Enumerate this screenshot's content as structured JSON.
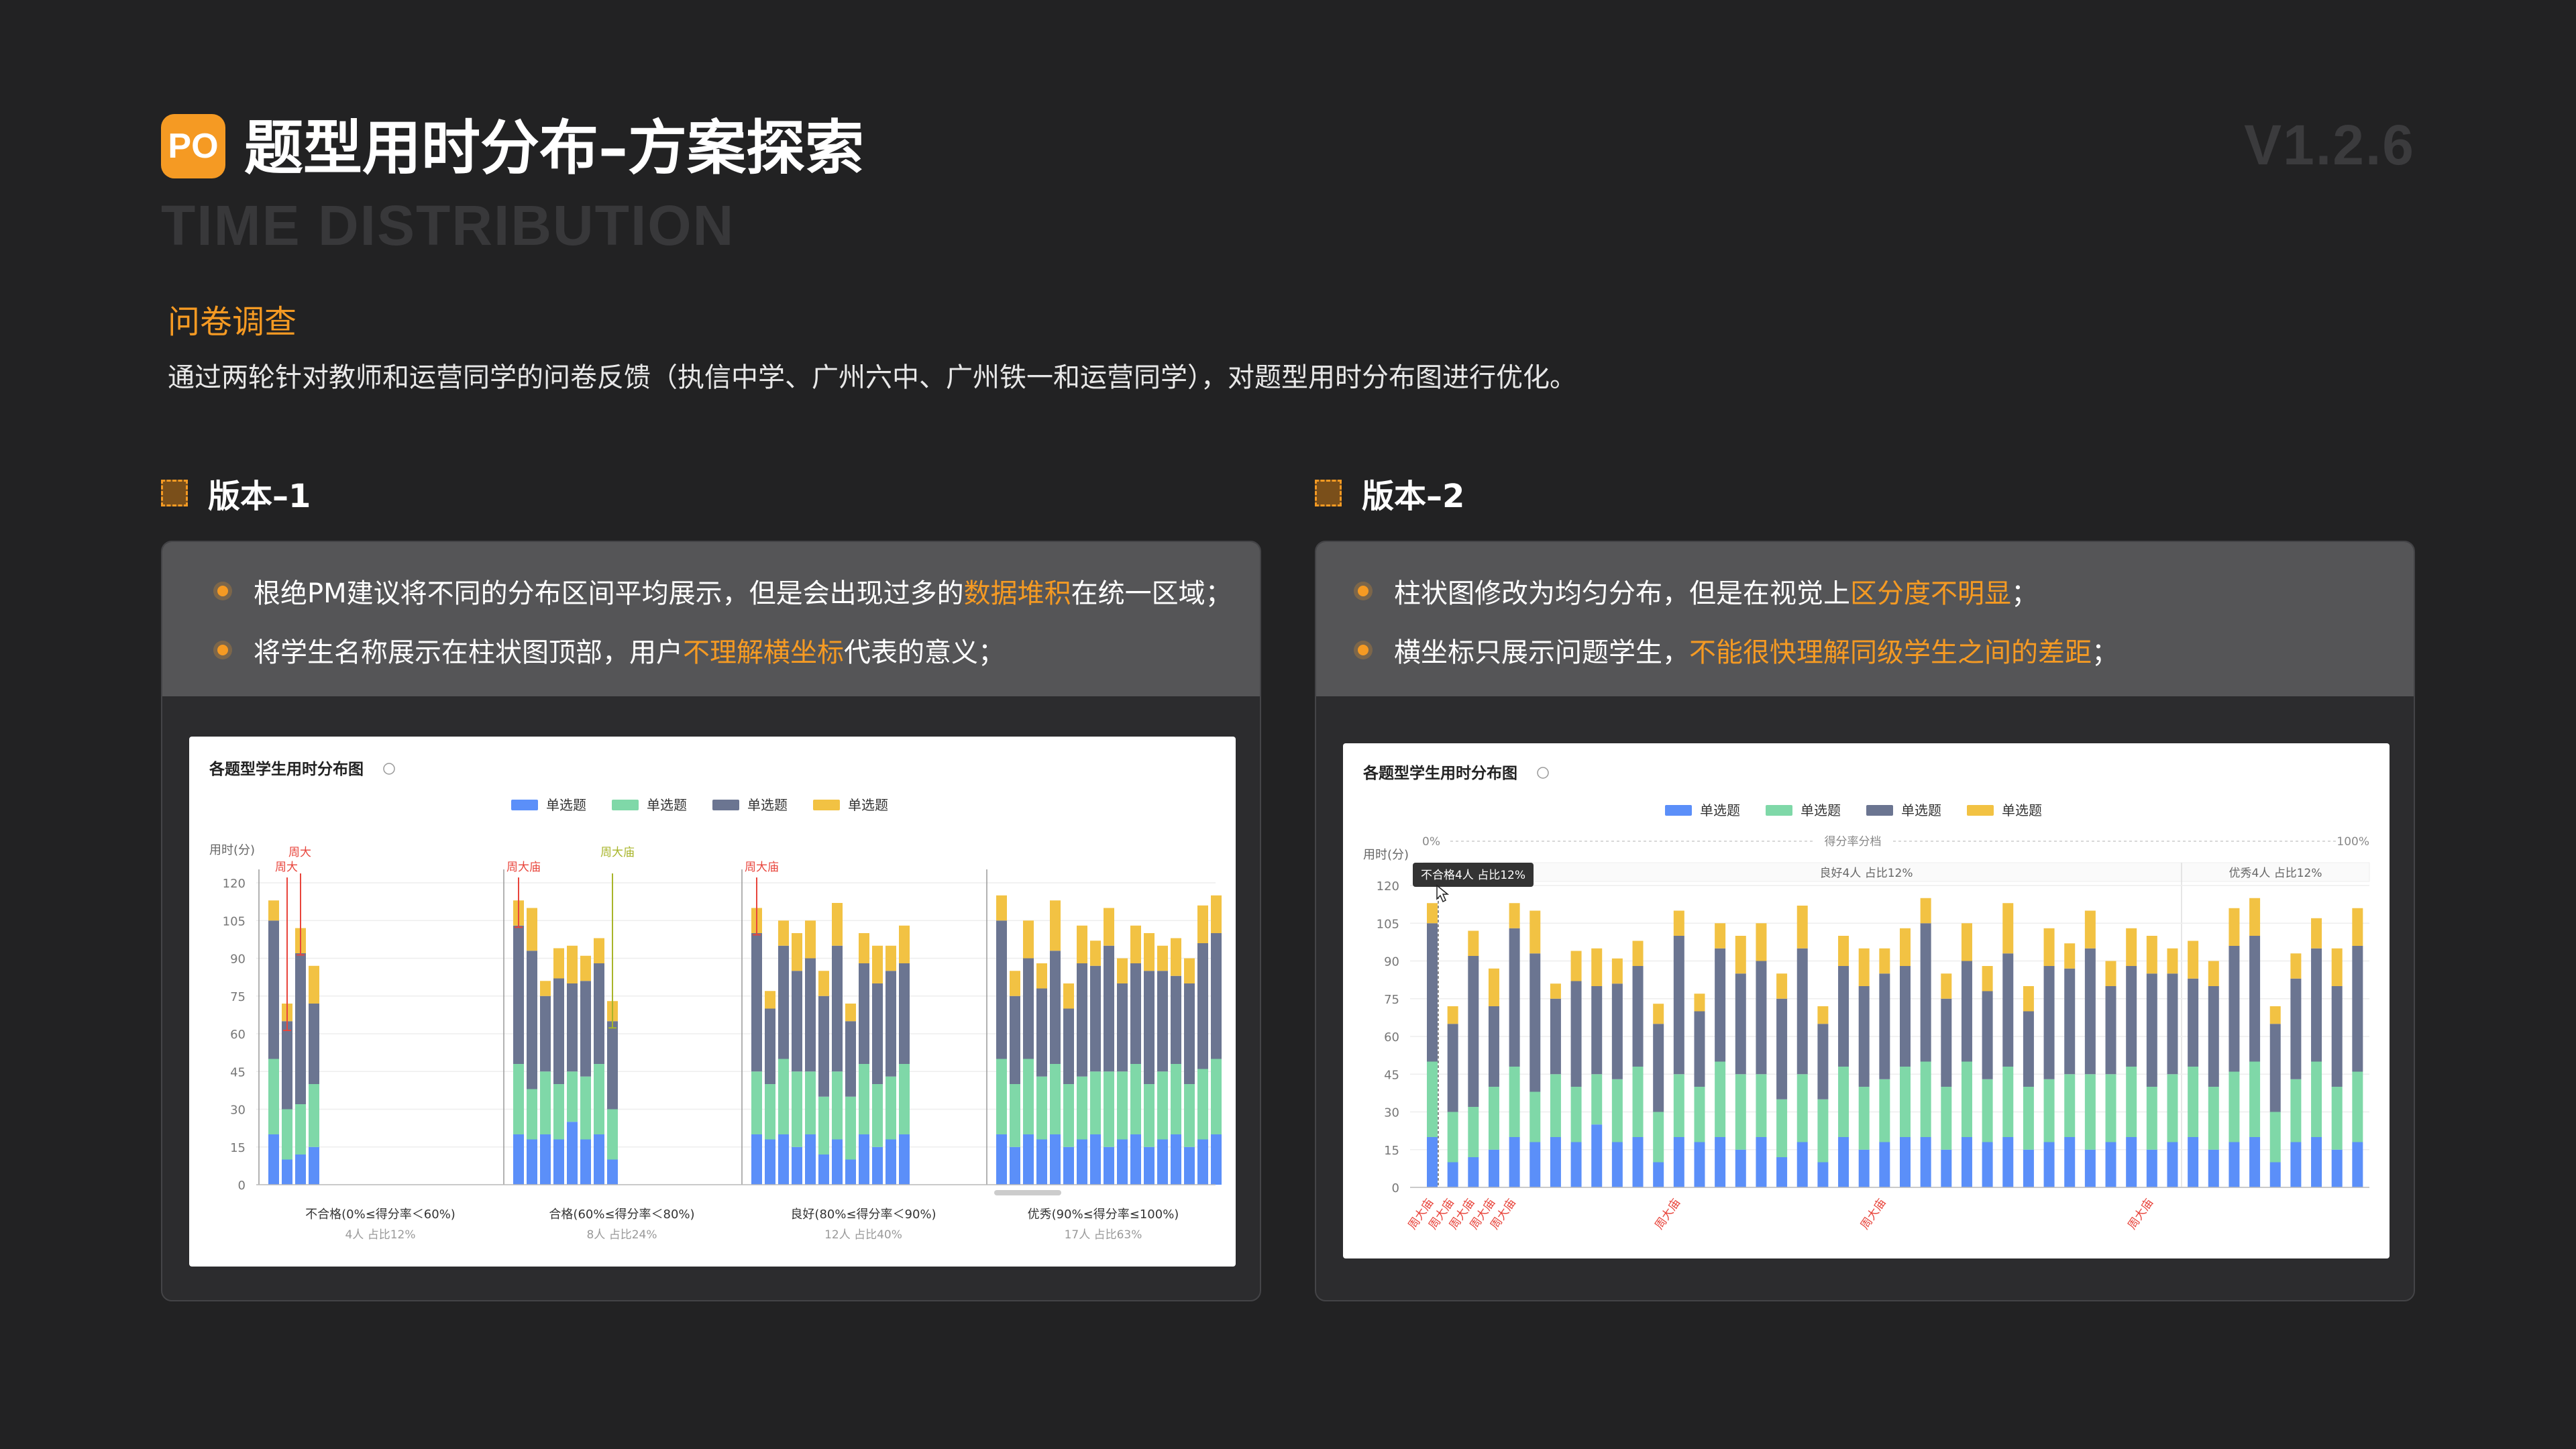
{
  "header": {
    "logo_text": "PO",
    "title": "题型用时分布–方案探索",
    "subtitle_en": "TIME DISTRIBUTION",
    "version": "V1.2.6"
  },
  "intro": {
    "section_title": "问卷调查",
    "description": "通过两轮针对教师和运营同学的问卷反馈（执信中学、广州六中、广州铁一和运营同学），对题型用时分布图进行优化。"
  },
  "version1": {
    "heading": "版本–1",
    "bullets": [
      {
        "pre": "根绝PM建议将不同的分布区间平均展示，但是会出现过多的",
        "hl": "数据堆积",
        "post": "在统一区域；"
      },
      {
        "pre": "将学生名称展示在柱状图顶部，用户",
        "hl": "不理解横坐标",
        "post": "代表的意义；"
      }
    ],
    "chart": {
      "title": "各题型学生用时分布图",
      "ylabel": "用时(分)",
      "legend": [
        "单选题",
        "单选题",
        "单选题",
        "单选题"
      ],
      "group_labels": [
        "不合格(0%≤得分率＜60%)",
        "合格(60%≤得分率＜80%)",
        "良好(80%≤得分率＜90%)",
        "优秀(90%≤得分率≤100%)"
      ],
      "group_counts": [
        "4人 占比12%",
        "8人 占比24%",
        "12人 占比40%",
        "17人 占比63%"
      ],
      "annotations": [
        "周大",
        "周大",
        "周大庙",
        "周大庙",
        "周大庙"
      ]
    }
  },
  "version2": {
    "heading": "版本–2",
    "bullets": [
      {
        "pre": "柱状图修改为均匀分布，但是在视觉上",
        "hl": "区分度不明显",
        "post": "；"
      },
      {
        "pre": "横坐标只展示问题学生，",
        "hl": "不能很快理解同级学生之间的差距",
        "post": "；"
      }
    ],
    "chart": {
      "title": "各题型学生用时分布图",
      "ylabel": "用时(分)",
      "legend": [
        "单选题",
        "单选题",
        "单选题",
        "单选题"
      ],
      "scale_left": "0%",
      "scale_mid": "得分率分档",
      "scale_right": "100%",
      "band_labels": [
        "良好4人 占比12%",
        "优秀4人 占比12%"
      ],
      "tooltip": "不合格4人 占比12%",
      "x_labels": [
        "周大庙",
        "周大庙",
        "周大庙",
        "周大庙",
        "周大庙",
        "周大庙",
        "周大庙",
        "周大庙"
      ]
    }
  },
  "colors": {
    "accent": "#F59A23",
    "bar_blue": "#5B8FF9",
    "bar_green": "#7FD8A8",
    "bar_slate": "#6B7591",
    "bar_yellow": "#F2C243",
    "annot_red": "#E8453C",
    "annot_olive": "#A8B52A"
  },
  "chart_data": [
    {
      "type": "bar",
      "stacked": true,
      "title": "各题型学生用时分布图",
      "ylabel": "用时(分)",
      "ylim": [
        0,
        120
      ],
      "yticks": [
        0,
        15,
        30,
        45,
        60,
        75,
        90,
        105,
        120
      ],
      "series": [
        {
          "name": "单选题",
          "color": "#5B8FF9"
        },
        {
          "name": "单选题",
          "color": "#7FD8A8"
        },
        {
          "name": "单选题",
          "color": "#6B7591"
        },
        {
          "name": "单选题",
          "color": "#F2C243"
        }
      ],
      "groups": [
        {
          "label": "不合格(0%≤得分率＜60%)",
          "bars": [
            [
              20,
              30,
              55,
              8
            ],
            [
              10,
              20,
              35,
              7
            ],
            [
              12,
              20,
              60,
              10
            ],
            [
              15,
              25,
              32,
              15
            ]
          ]
        },
        {
          "label": "合格(60%≤得分率＜80%)",
          "bars": [
            [
              20,
              28,
              55,
              10
            ],
            [
              18,
              20,
              55,
              17
            ],
            [
              20,
              25,
              30,
              6
            ],
            [
              18,
              22,
              42,
              12
            ],
            [
              25,
              20,
              35,
              15
            ],
            [
              18,
              25,
              38,
              10
            ],
            [
              20,
              28,
              40,
              10
            ],
            [
              10,
              20,
              35,
              8
            ]
          ]
        },
        {
          "label": "良好(80%≤得分率＜90%)",
          "bars": [
            [
              20,
              25,
              55,
              10
            ],
            [
              18,
              22,
              30,
              7
            ],
            [
              20,
              30,
              45,
              10
            ],
            [
              15,
              30,
              40,
              15
            ],
            [
              20,
              25,
              45,
              15
            ],
            [
              12,
              23,
              40,
              10
            ],
            [
              18,
              27,
              50,
              17
            ],
            [
              10,
              25,
              30,
              7
            ],
            [
              20,
              28,
              40,
              12
            ],
            [
              15,
              25,
              40,
              15
            ],
            [
              18,
              25,
              42,
              10
            ],
            [
              20,
              28,
              40,
              15
            ]
          ]
        },
        {
          "label": "优秀(90%≤得分率≤100%)",
          "bars": [
            [
              20,
              30,
              55,
              10
            ],
            [
              15,
              25,
              35,
              10
            ],
            [
              20,
              30,
              40,
              15
            ],
            [
              18,
              25,
              35,
              10
            ],
            [
              20,
              28,
              45,
              20
            ],
            [
              15,
              25,
              30,
              10
            ],
            [
              18,
              25,
              45,
              15
            ],
            [
              20,
              25,
              42,
              10
            ],
            [
              15,
              30,
              50,
              15
            ],
            [
              18,
              27,
              35,
              10
            ],
            [
              20,
              28,
              40,
              15
            ],
            [
              15,
              25,
              45,
              15
            ],
            [
              18,
              27,
              40,
              10
            ],
            [
              20,
              28,
              35,
              15
            ],
            [
              15,
              25,
              40,
              10
            ],
            [
              18,
              28,
              50,
              15
            ],
            [
              20,
              30,
              50,
              15
            ]
          ]
        }
      ]
    },
    {
      "type": "bar",
      "stacked": true,
      "title": "各题型学生用时分布图",
      "ylabel": "用时(分)",
      "ylim": [
        0,
        120
      ],
      "yticks": [
        0,
        15,
        30,
        45,
        60,
        75,
        90,
        105,
        120
      ],
      "series": [
        {
          "name": "单选题",
          "color": "#5B8FF9"
        },
        {
          "name": "单选题",
          "color": "#7FD8A8"
        },
        {
          "name": "单选题",
          "color": "#6B7591"
        },
        {
          "name": "单选题",
          "color": "#F2C243"
        }
      ],
      "bars": [
        [
          20,
          30,
          55,
          8
        ],
        [
          10,
          20,
          35,
          7
        ],
        [
          12,
          20,
          60,
          10
        ],
        [
          15,
          25,
          32,
          15
        ],
        [
          20,
          28,
          55,
          10
        ],
        [
          18,
          20,
          55,
          17
        ],
        [
          20,
          25,
          30,
          6
        ],
        [
          18,
          22,
          42,
          12
        ],
        [
          25,
          20,
          35,
          15
        ],
        [
          18,
          25,
          38,
          10
        ],
        [
          20,
          28,
          40,
          10
        ],
        [
          10,
          20,
          35,
          8
        ],
        [
          20,
          25,
          55,
          10
        ],
        [
          18,
          22,
          30,
          7
        ],
        [
          20,
          30,
          45,
          10
        ],
        [
          15,
          30,
          40,
          15
        ],
        [
          20,
          25,
          45,
          15
        ],
        [
          12,
          23,
          40,
          10
        ],
        [
          18,
          27,
          50,
          17
        ],
        [
          10,
          25,
          30,
          7
        ],
        [
          20,
          28,
          40,
          12
        ],
        [
          15,
          25,
          40,
          15
        ],
        [
          18,
          25,
          42,
          10
        ],
        [
          20,
          28,
          40,
          15
        ],
        [
          20,
          30,
          55,
          10
        ],
        [
          15,
          25,
          35,
          10
        ],
        [
          20,
          30,
          40,
          15
        ],
        [
          18,
          25,
          35,
          10
        ],
        [
          20,
          28,
          45,
          20
        ],
        [
          15,
          25,
          30,
          10
        ],
        [
          18,
          25,
          45,
          15
        ],
        [
          20,
          25,
          42,
          10
        ],
        [
          15,
          30,
          50,
          15
        ],
        [
          18,
          27,
          35,
          10
        ],
        [
          20,
          28,
          40,
          15
        ],
        [
          15,
          25,
          45,
          15
        ],
        [
          18,
          27,
          40,
          10
        ],
        [
          20,
          28,
          35,
          15
        ],
        [
          15,
          25,
          40,
          10
        ],
        [
          18,
          28,
          50,
          15
        ],
        [
          20,
          30,
          50,
          15
        ],
        [
          10,
          20,
          35,
          7
        ],
        [
          18,
          25,
          40,
          10
        ],
        [
          20,
          30,
          45,
          12
        ],
        [
          15,
          25,
          40,
          15
        ],
        [
          18,
          28,
          50,
          15
        ]
      ]
    }
  ]
}
